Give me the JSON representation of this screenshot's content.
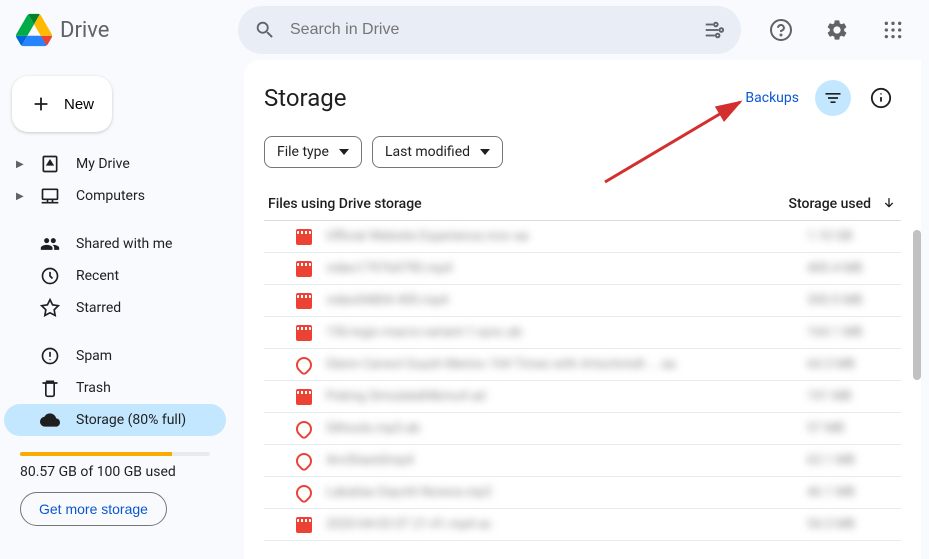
{
  "header": {
    "logo_text": "Drive",
    "search_placeholder": "Search in Drive"
  },
  "sidebar": {
    "new_label": "New",
    "nav_primary": [
      {
        "label": "My Drive",
        "expandable": true
      },
      {
        "label": "Computers",
        "expandable": true
      }
    ],
    "nav_secondary": [
      {
        "label": "Shared with me"
      },
      {
        "label": "Recent"
      },
      {
        "label": "Starred"
      }
    ],
    "nav_tertiary": [
      {
        "label": "Spam"
      },
      {
        "label": "Trash"
      },
      {
        "label": "Storage (80% full)",
        "active": true
      }
    ],
    "storage_text": "80.57 GB of 100 GB used",
    "more_storage": "Get more storage",
    "storage_percent": 80
  },
  "main": {
    "title": "Storage",
    "backups_link": "Backups",
    "chip_file_type": "File type",
    "chip_last_modified": "Last modified",
    "col_files": "Files using Drive storage",
    "col_storage": "Storage used",
    "files": [
      {
        "icon": "video",
        "name": "Official Website Experience.mov aa",
        "size": "1.10 GB"
      },
      {
        "icon": "video",
        "name": "video179764790.mp4",
        "size": "400.4 MB"
      },
      {
        "icon": "video",
        "name": "video04804 400.mp4",
        "size": "300.0 MB"
      },
      {
        "icon": "video",
        "name": "156-logic-macro-variant-1-sync.ab",
        "size": "164.1 MB"
      },
      {
        "icon": "audio",
        "name": "Glenn Carwol Guysh Merino 104 Times with Artschmidt ... aa",
        "size": "64.3 MB"
      },
      {
        "icon": "video",
        "name": "Poking Simulate84bmo4 ad",
        "size": "191 MB"
      },
      {
        "icon": "audio",
        "name": "Silhouts.mp3.ab",
        "size": "57 MB"
      },
      {
        "icon": "audio",
        "name": "4nvShareSmp4",
        "size": "63.1 MB"
      },
      {
        "icon": "audio",
        "name": "Lakaitas Dayvitt Noreva.mp3",
        "size": "46.1 MB"
      },
      {
        "icon": "video",
        "name": "2020-04-03 07 21-41.mp4 ac",
        "size": "54.3 MB"
      }
    ]
  }
}
